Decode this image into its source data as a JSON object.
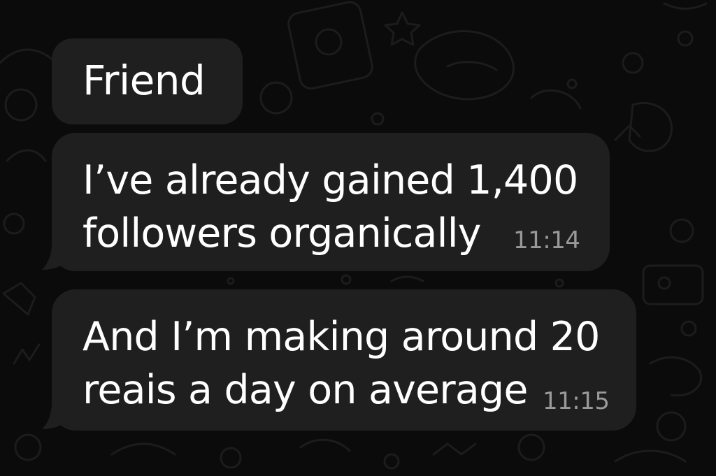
{
  "chat": {
    "sender_name": "Friend",
    "messages": [
      {
        "lines": [
          "I’ve already gained 1,400",
          "followers organically"
        ],
        "time": "11:14"
      },
      {
        "lines": [
          "And I’m making around 20",
          "reais a day on average"
        ],
        "time": "11:15"
      }
    ]
  },
  "colors": {
    "background": "#0b0b0b",
    "bubble": "#1f1f1f",
    "text": "#ffffff",
    "timestamp": "#9a9a9a",
    "wallpaper_doodle": "#1c1c1c"
  },
  "icons": [
    "chat-wallpaper-doodles"
  ]
}
